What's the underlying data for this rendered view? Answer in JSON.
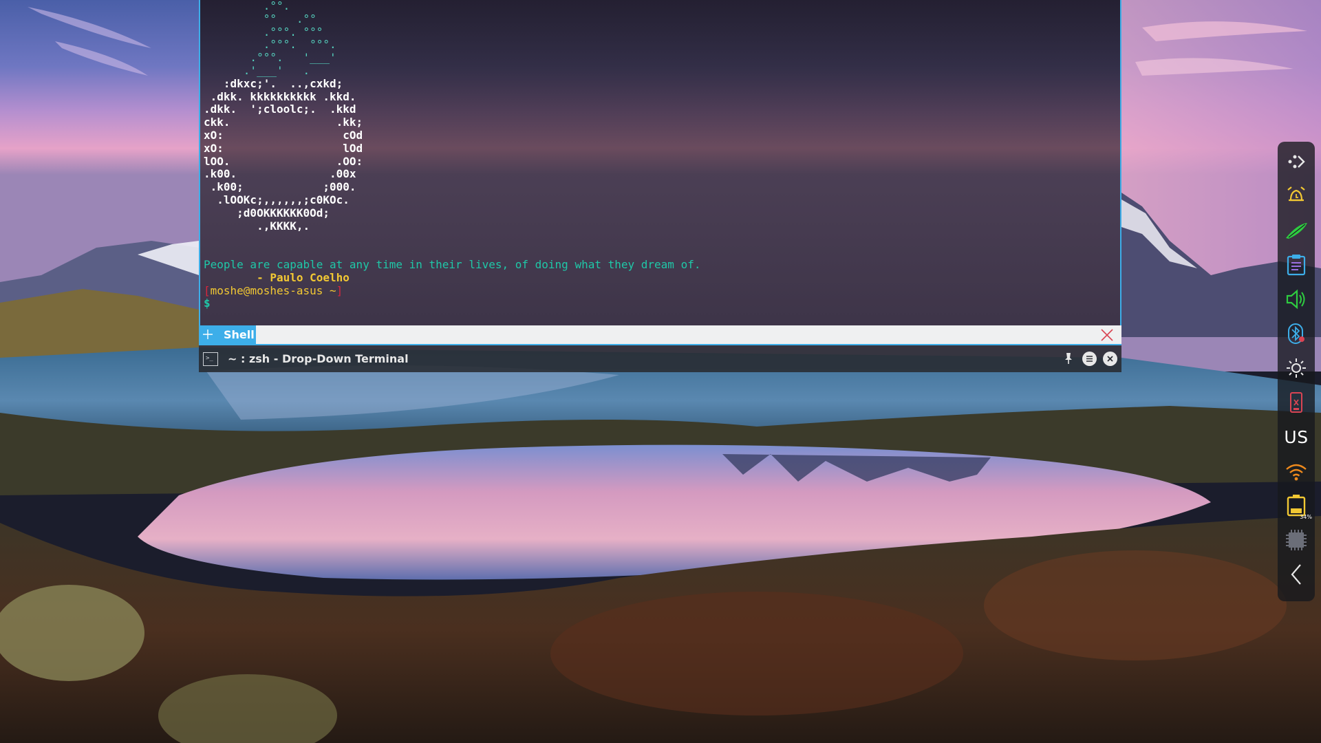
{
  "terminal": {
    "ascii_top": [
      "         .°°.",
      "         °°   .°°",
      "         .°°°. °°°",
      "         .°°°.  °°°.",
      "       .°°°.   '___'",
      "      .'___'   ."
    ],
    "ascii_body": [
      "   :dkxc;'.  ..,cxkd;",
      " .dkk. kkkkkkkkkk .kkd.",
      ".dkk.  ';cloolc;.  .kkd",
      "ckk.                .kk;",
      "xO:                  cOd",
      "xO:                  lOd",
      "lOO.                .OO:",
      ".k00.              .00x",
      " .k00;            ;000.",
      "  .lOOKc;,,,,,,;c0KOc.",
      "     ;d0OKKKKKK0Od;",
      "        .,KKKK,."
    ],
    "quote": "People are capable at any time in their lives, of doing what they dream of.",
    "author": "        - Paulo Coelho",
    "prompt_open": "[",
    "prompt_user": "moshe@moshes-asus ~",
    "prompt_close": "]",
    "prompt_symbol": "$"
  },
  "tabs": [
    {
      "label": "Shell",
      "active": true
    }
  ],
  "window": {
    "title": "~ : zsh - Drop-Down Terminal"
  },
  "panel": {
    "keyboard_layout": "US",
    "battery_percent": "34%"
  },
  "colors": {
    "accent": "#3daee9",
    "close_red": "#da4453",
    "terminal_green": "#1fc8a8",
    "terminal_yellow": "#f2c833"
  }
}
